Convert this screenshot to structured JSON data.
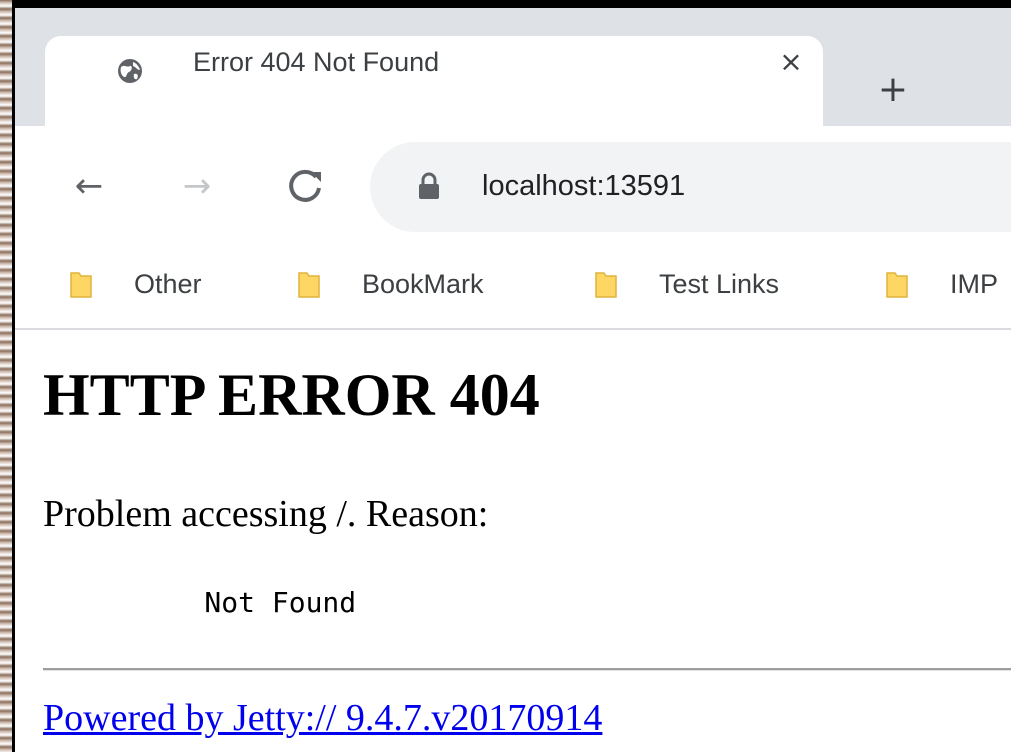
{
  "browser": {
    "tab": {
      "title": "Error 404 Not Found",
      "favicon": "globe-icon",
      "close_symbol": "×"
    },
    "new_tab_symbol": "+",
    "toolbar": {
      "back_symbol": "←",
      "forward_symbol": "→",
      "reload_symbol": "C",
      "url": "localhost:13591"
    },
    "bookmarks": [
      {
        "label": "Other",
        "icon": "folder-icon"
      },
      {
        "label": "BookMark",
        "icon": "folder-icon"
      },
      {
        "label": "Test Links",
        "icon": "folder-icon"
      },
      {
        "label": "IMP",
        "icon": "folder-icon"
      }
    ]
  },
  "page": {
    "heading": "HTTP ERROR 404",
    "problem_text": "Problem accessing /. Reason:",
    "reason": "    Not Found",
    "footer_link": "Powered by Jetty:// 9.4.7.v20170914"
  },
  "colors": {
    "tabstrip": "#dee1e6",
    "omnibox": "#f1f3f4",
    "folder": "#fdd663",
    "link": "#0000ee"
  }
}
